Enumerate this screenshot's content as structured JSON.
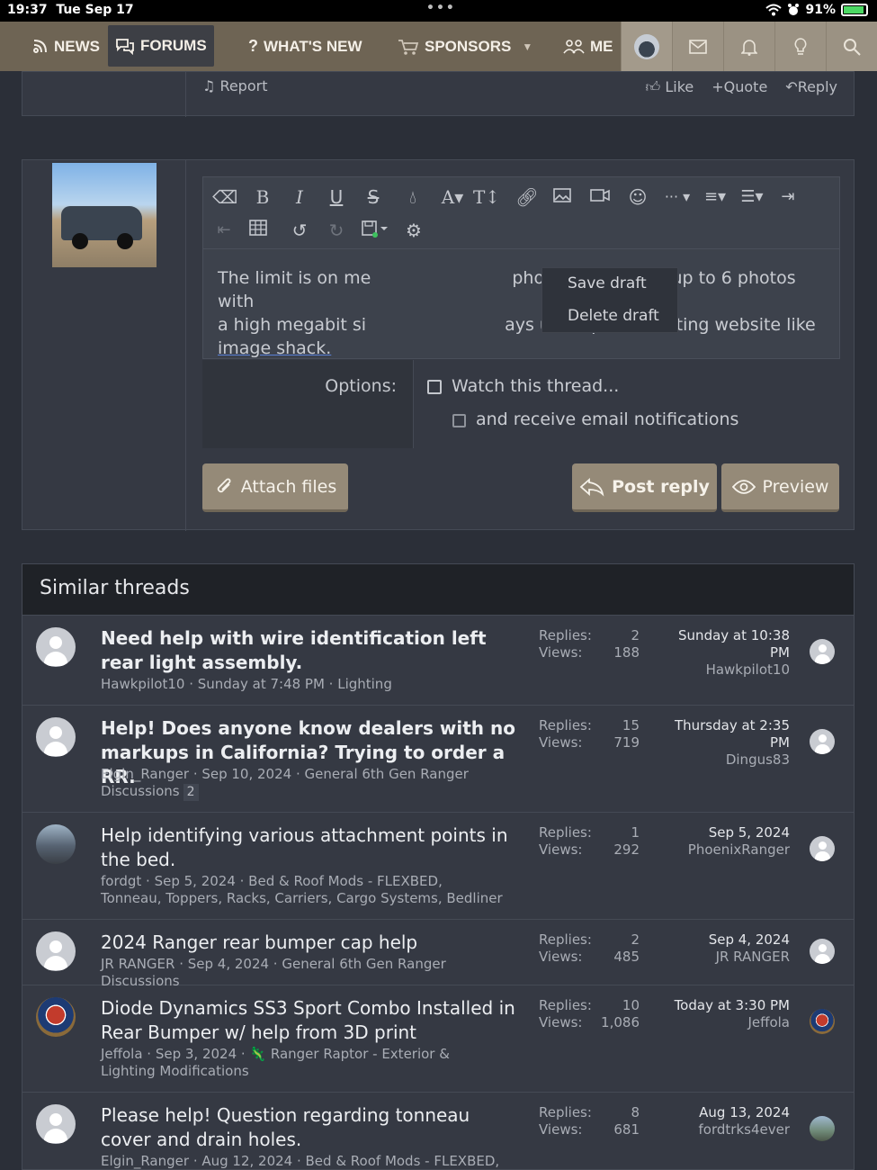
{
  "status_bar": {
    "time": "19:37",
    "date": "Tue Sep 17",
    "battery": "91%"
  },
  "nav": {
    "news": "NEWS",
    "forums": "FORUMS",
    "whats_new": "WHAT'S NEW",
    "sponsors": "SPONSORS",
    "members_partial": "ME"
  },
  "post": {
    "report": "Report",
    "like": "Like",
    "quote": "Quote",
    "reply": "Reply"
  },
  "editor": {
    "text": "The limit is on me",
    "text_after_line1": "photo.   I've posted up to 6 photos with",
    "text_line2_start": "a high megabit si",
    "text_line2_end": "ays use a photo hosting website like",
    "text_line3": "image shack.",
    "draft_menu": {
      "save": "Save draft",
      "delete": "Delete draft"
    }
  },
  "options": {
    "label": "Options:",
    "watch": "Watch this thread...",
    "email": "and receive email notifications"
  },
  "buttons": {
    "attach": "Attach files",
    "post_reply": "Post reply",
    "preview": "Preview"
  },
  "similar": {
    "heading": "Similar threads",
    "replies_label": "Replies:",
    "views_label": "Views:",
    "threads": [
      {
        "title": "Need help with wire identification left rear light assembly.",
        "bold": true,
        "meta": "Hawkpilot10 · Sunday at 7:48 PM · Lighting",
        "page": "",
        "replies": "2",
        "views": "188",
        "last_date": "Sunday at 10:38 PM",
        "last_user": "Hawkpilot10"
      },
      {
        "title": "Help! Does anyone know dealers with no markups in California? Trying to order a RR.",
        "bold": true,
        "meta": "Elgin_Ranger · Sep 10, 2024 · General 6th Gen Ranger Discussions",
        "page": "2",
        "replies": "15",
        "views": "719",
        "last_date": "Thursday at 2:35 PM",
        "last_user": "Dingus83"
      },
      {
        "title": "Help identifying various attachment points in the bed.",
        "bold": false,
        "meta": "fordgt · Sep 5, 2024 · Bed & Roof Mods - FLEXBED, Tonneau, Toppers, Racks, Carriers, Cargo Systems, Bedliner",
        "page": "",
        "replies": "1",
        "views": "292",
        "last_date": "Sep 5, 2024",
        "last_user": "PhoenixRanger"
      },
      {
        "title": "2024 Ranger rear bumper cap help",
        "bold": false,
        "meta": "JR RANGER · Sep 4, 2024 · General 6th Gen Ranger Discussions",
        "page": "",
        "replies": "2",
        "views": "485",
        "last_date": "Sep 4, 2024",
        "last_user": "JR RANGER"
      },
      {
        "title": "Diode Dynamics SS3 Sport Combo Installed in Rear Bumper w/ help from 3D print",
        "bold": false,
        "meta": "Jeffola · Sep 3, 2024 · 🦎 Ranger Raptor - Exterior & Lighting Modifications",
        "page": "",
        "replies": "10",
        "views": "1,086",
        "last_date": "Today at 3:30 PM",
        "last_user": "Jeffola"
      },
      {
        "title": "Please help! Question regarding tonneau cover and drain holes.",
        "bold": false,
        "meta": "Elgin_Ranger · Aug 12, 2024 · Bed & Roof Mods - FLEXBED,",
        "page": "",
        "replies": "8",
        "views": "681",
        "last_date": "Aug 13, 2024",
        "last_user": "fordtrks4ever"
      }
    ]
  }
}
